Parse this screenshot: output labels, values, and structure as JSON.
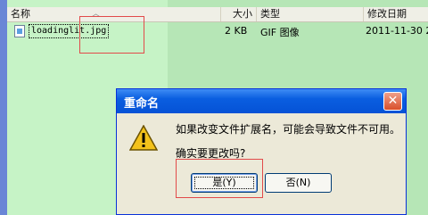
{
  "header": {
    "columns": [
      "名称",
      "大小",
      "类型",
      "修改日期"
    ],
    "sort_indicator": "chevron-up"
  },
  "file_row": {
    "name": "loadinglit.jpg",
    "size": "2 KB",
    "type": "GIF 图像",
    "modified": "2011-11-30 2"
  },
  "dialog": {
    "title": "重命名",
    "close_symbol": "✕",
    "message_line1": "如果改变文件扩展名，可能会导致文件不可用。",
    "message_line2": "确实要更改吗?",
    "yes_label": "是(Y)",
    "no_label": "否(N)"
  }
}
